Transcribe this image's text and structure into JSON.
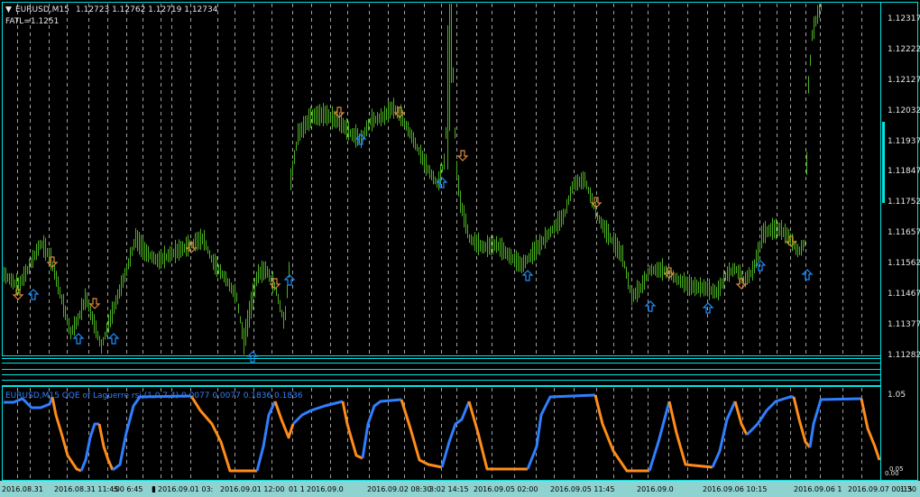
{
  "main_chart": {
    "header_symbol": "EURUSD,M15",
    "header_prices": "1.12723 1.12762 1.12719 1.12734",
    "indicator_label": "FATL=1.1251",
    "price_scale": [
      "1.12317",
      "1.12222",
      "1.12127",
      "1.12032",
      "1.11937",
      "1.11847",
      "1.11752",
      "1.11657",
      "1.11562",
      "1.11467",
      "1.11377",
      "1.11282"
    ],
    "price_min": 1.1121,
    "price_max": 1.1241
  },
  "sub_window": {
    "title": "EURUSD,M15 QQE of Laguerre rsi (1,0.7,4) 0.0077 0.0077 0.1836 0.1836",
    "scale_top": "1.05",
    "scale_bottom_a": "0.05",
    "scale_bottom_b": "0.00"
  },
  "time_axis": [
    "2016.08.31",
    "2016.08.31 11:45",
    "2016.09.01 03:",
    "2016.09.01 12:00",
    "2016.09.0",
    "2016.09.02 08:30",
    "2016.09.02 14:15",
    "2016.09.05 02:00",
    "2016.09.05 11:45",
    "2016.09.0",
    "2016.09.06 10:15",
    "2016.09.06 1",
    "2016.09.07 00:15"
  ],
  "time_axis_fragments": [
    ":00 6:45",
    "01 1",
    "3:02 14:15",
    "1:30"
  ],
  "colors": {
    "bars": "#4caf1f",
    "up_arrow": "#1e90ff",
    "down_arrow": "#e08a3c",
    "grid": "#c8c8c8",
    "frame": "#00e5e5",
    "qqe_blue": "#2f7fff",
    "qqe_orange": "#ff8c1a"
  }
}
